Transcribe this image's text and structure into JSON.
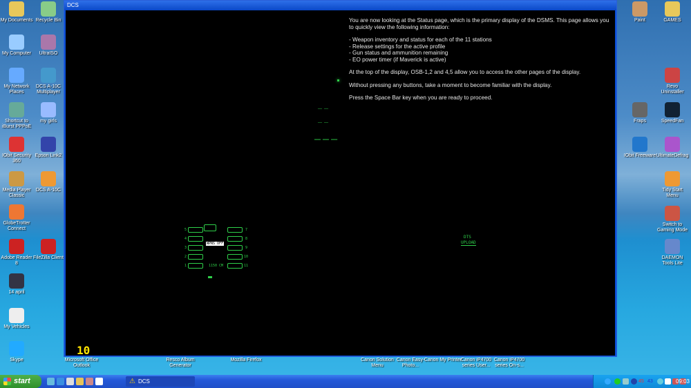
{
  "desktop": {
    "left_icons": [
      "My Documents",
      "Recycle Bin",
      "My Computer",
      "UltraISO",
      "My Network Places",
      "DCS A-10C Multiplayer",
      "Shortcut to iBurst PPPoE",
      "my girls",
      "IObit Security 360",
      "Epson Link2",
      "Media Player Classic",
      "DCS A-10C",
      "GlobeTrotter Connect",
      "Adobe Reader 8",
      "FileZilla Client",
      "14 april",
      "My Vehicles",
      "Skype"
    ],
    "right_icons": [
      "Paint",
      "GAMES",
      "Revo Uninstaller",
      "Fraps",
      "SpeedFan",
      "IObit Freeware",
      "UltimateDefrag",
      "Tidy Start Menu",
      "Switch to Gaming Mode",
      "DAEMON Tools Lite"
    ],
    "bottom_labels": [
      "Microsoft Office Outlook",
      "Resco Album Generator",
      "Mozilla Firefox",
      "Canon Solution Menu",
      "Canon Easy-Photo...",
      "Canon My Printer",
      "Canon iP4700 series User...",
      "Canon iP4700 series On-s..."
    ]
  },
  "window": {
    "title": "DCS"
  },
  "briefing": {
    "intro": "You are now looking at the Status page, which is the primary display of the DSMS. This page allows you to quickly view the following information:",
    "bullets": [
      "- Weapon inventory and status for each of the 11 stations",
      "- Release settings for the active profile",
      "- Gun status and ammunition remaining",
      "- EO power timer (if Maverick is active)"
    ],
    "osb": "At the top of the display, OSB-1,2 and 4,5 allow you to access the other pages of the display.",
    "familiar": "Without pressing any buttons, take a moment to become familiar with the display.",
    "proceed": "Press the Space Bar key when you are ready to proceed."
  },
  "mfd_left": {
    "weapons_status": "WPNS OFF",
    "gun_rounds": "1150 CM",
    "stations": [
      "5",
      "4",
      "3",
      "2",
      "1",
      "7",
      "8",
      "9",
      "10",
      "11"
    ]
  },
  "mfd_right": {
    "title": "DTS",
    "subtitle": "UPLOAD"
  },
  "fps_counter": "10",
  "taskbar": {
    "start": "start",
    "task": "DCS",
    "tray_numbers": [
      "45",
      "43"
    ],
    "clock": "09:03"
  }
}
